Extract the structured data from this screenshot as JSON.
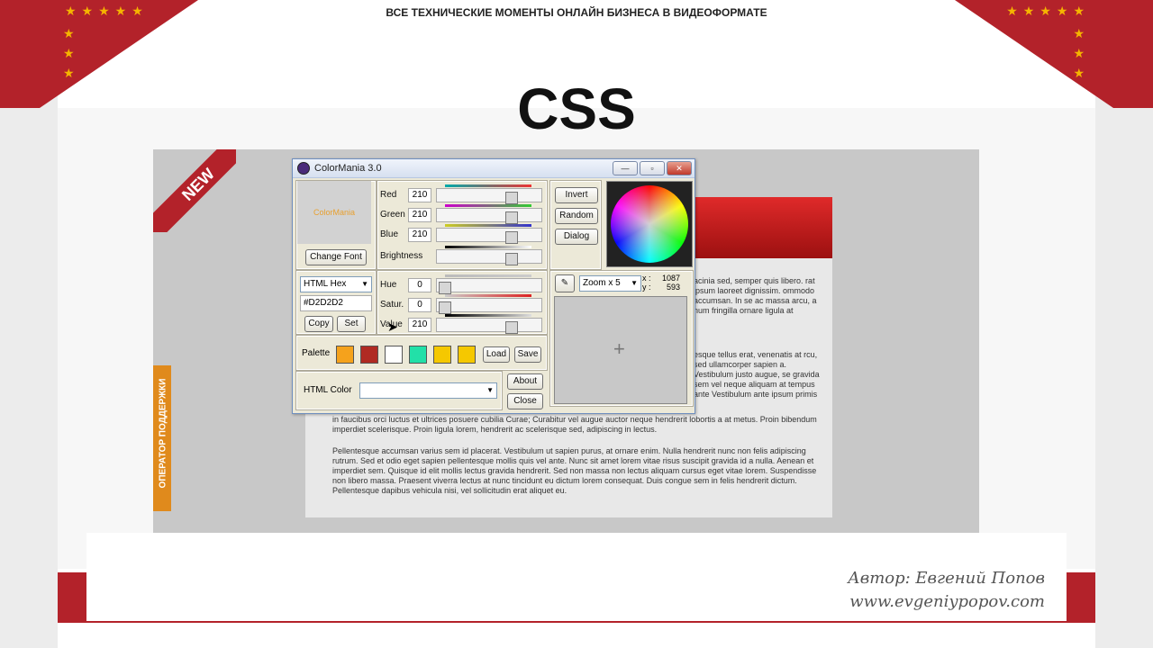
{
  "banner": {
    "title": "ВСЕ ТЕХНИЧЕСКИЕ МОМЕНТЫ ОНЛАЙН БИЗНЕСА В ВИДЕОФОРМАТЕ"
  },
  "heading": "CSS",
  "website": {
    "new_badge": "NEW",
    "support_tab": "ОПЕРАТОР ПОДДЕРЖКИ",
    "paragraph_right": "acinia sed, semper quis libero. rat ipsum laoreet dignissim. ommodo accumsan. In se ac massa arcu, a num fringilla ornare ligula at",
    "paragraph_mid": "esque tellus erat, venenatis at rcu, sed ullamcorper sapien a. Vestibulum justo augue, se gravida sem vel neque aliquam at tempus ante Vestibulum ante ipsum primis",
    "paragraph_1": "in faucibus orci luctus et ultrices posuere cubilia Curae; Curabitur vel augue auctor neque hendrerit lobortis a at metus. Proin bibendum imperdiet scelerisque. Proin ligula lorem, hendrerit ac scelerisque sed, adipiscing in lectus.",
    "paragraph_2": "Pellentesque accumsan varius sem id placerat. Vestibulum ut sapien purus, at ornare enim. Nulla hendrerit nunc non felis adipiscing rutrum. Sed et odio eget sapien pellentesque mollis quis vel ante. Nunc sit amet lorem vitae risus suscipit gravida id a nulla. Aenean et imperdiet sem. Quisque id elit mollis lectus gravida hendrerit. Sed non massa non lectus aliquam cursus eget vitae lorem. Suspendisse non libero massa. Praesent viverra lectus at nunc tincidunt eu dictum lorem consequat. Duis congue sem in felis hendrerit dictum. Pellentesque dapibus vehicula nisi, vel sollicitudin erat aliquet eu."
  },
  "colormania": {
    "title": "ColorMania 3.0",
    "preview_text": "ColorMania",
    "change_font": "Change Font",
    "sliders": [
      {
        "label": "Red",
        "value": "210"
      },
      {
        "label": "Green",
        "value": "210"
      },
      {
        "label": "Blue",
        "value": "210"
      },
      {
        "label": "Brightness",
        "value": ""
      }
    ],
    "hsv": [
      {
        "label": "Hue",
        "value": "0"
      },
      {
        "label": "Satur.",
        "value": "0"
      },
      {
        "label": "Value",
        "value": "210"
      }
    ],
    "format_select": "HTML Hex",
    "hex_value": "#D2D2D2",
    "copy": "Copy",
    "set": "Set",
    "invert": "Invert",
    "random": "Random",
    "dialog": "Dialog",
    "zoom_select": "Zoom x 5",
    "coord_x_label": "x :",
    "coord_x": "1087",
    "coord_y_label": "y :",
    "coord_y": "593",
    "palette_label": "Palette",
    "palette_colors": [
      "#f5a21c",
      "#b02a23",
      "#ffffff",
      "#22e0a8",
      "#f5c800",
      "#f5c800"
    ],
    "load": "Load",
    "save": "Save",
    "html_color_label": "HTML Color",
    "html_color_value": "",
    "about": "About",
    "close": "Close"
  },
  "signature": {
    "author": "Автор: Евгений Попов",
    "site": "www.evgeniypopov.com"
  }
}
